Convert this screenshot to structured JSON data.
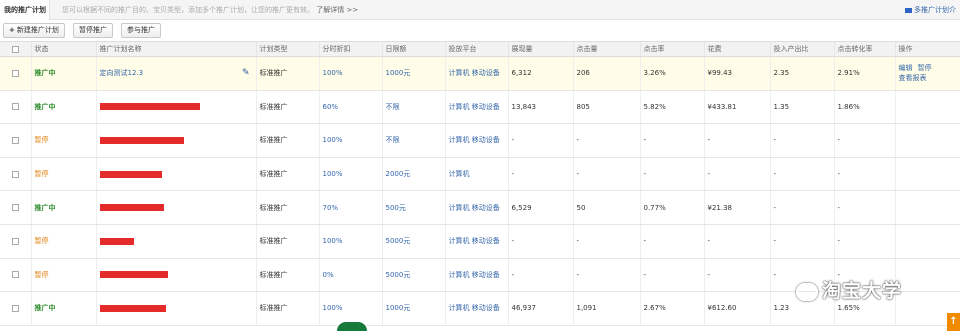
{
  "topbar": {
    "tab_label": "我的推广计划",
    "tip": "您可以根据不同的推广目的、宝贝类型，添加多个推广计划，让您的推广更有效。",
    "learn": "了解详情 >>",
    "multi": "多推广计划介"
  },
  "toolbar": {
    "new_label": "新建推广计划",
    "pause_label": "暂停推广",
    "resume_label": "参与推广"
  },
  "table": {
    "headers": [
      "状态",
      "推广计划名称",
      "计划类型",
      "分时折扣",
      "日限额",
      "投放平台",
      "展现量",
      "点击量",
      "点击率",
      "花费",
      "投入产出比",
      "点击转化率",
      "操作"
    ],
    "rows": [
      {
        "status": "推广中",
        "name": "定向测试12.3",
        "type": "标准推广",
        "discount": "100%",
        "limit": "1000元",
        "platform": "计算机 移动设备",
        "impr": "6,312",
        "clicks": "206",
        "ctr": "3.26%",
        "cost": "¥99.43",
        "roi": "2.35",
        "cvr": "2.91%",
        "ops": [
          "编辑",
          "暂停",
          "查看报表"
        ]
      },
      {
        "status": "推广中",
        "type": "标准推广",
        "discount": "60%",
        "limit": "不限",
        "platform": "计算机 移动设备",
        "impr": "13,843",
        "clicks": "805",
        "ctr": "5.82%",
        "cost": "¥433.81",
        "roi": "1.35",
        "cvr": "1.86%"
      },
      {
        "status": "暂停",
        "type": "标准推广",
        "discount": "100%",
        "limit": "不限",
        "platform": "计算机 移动设备",
        "impr": "-",
        "clicks": "-",
        "ctr": "-",
        "cost": "-",
        "roi": "-",
        "cvr": "-"
      },
      {
        "status": "暂停",
        "type": "标准推广",
        "discount": "100%",
        "limit": "2000元",
        "platform": "计算机",
        "impr": "-",
        "clicks": "-",
        "ctr": "-",
        "cost": "-",
        "roi": "-",
        "cvr": "-"
      },
      {
        "status": "推广中",
        "type": "标准推广",
        "discount": "70%",
        "limit": "500元",
        "platform": "计算机 移动设备",
        "impr": "6,529",
        "clicks": "50",
        "ctr": "0.77%",
        "cost": "¥21.38",
        "roi": "-",
        "cvr": "-"
      },
      {
        "status": "暂停",
        "type": "标准推广",
        "discount": "100%",
        "limit": "5000元",
        "platform": "计算机 移动设备",
        "impr": "-",
        "clicks": "-",
        "ctr": "-",
        "cost": "-",
        "roi": "-",
        "cvr": "-"
      },
      {
        "status": "暂停",
        "type": "标准推广",
        "discount": "0%",
        "limit": "5000元",
        "platform": "计算机 移动设备",
        "impr": "-",
        "clicks": "-",
        "ctr": "-",
        "cost": "-",
        "roi": "-",
        "cvr": "-"
      },
      {
        "status": "推广中",
        "type": "标准推广",
        "discount": "100%",
        "limit": "1000元",
        "platform": "计算机 移动设备",
        "impr": "46,937",
        "clicks": "1,091",
        "ctr": "2.67%",
        "cost": "¥612.60",
        "roi": "1.23",
        "cvr": "1.65%"
      }
    ]
  },
  "watermark": "淘宝大学",
  "colors": {
    "running": "#2a8a2a",
    "paused": "#e07a00",
    "link": "#3366aa",
    "redacted": "#e52a2a"
  }
}
